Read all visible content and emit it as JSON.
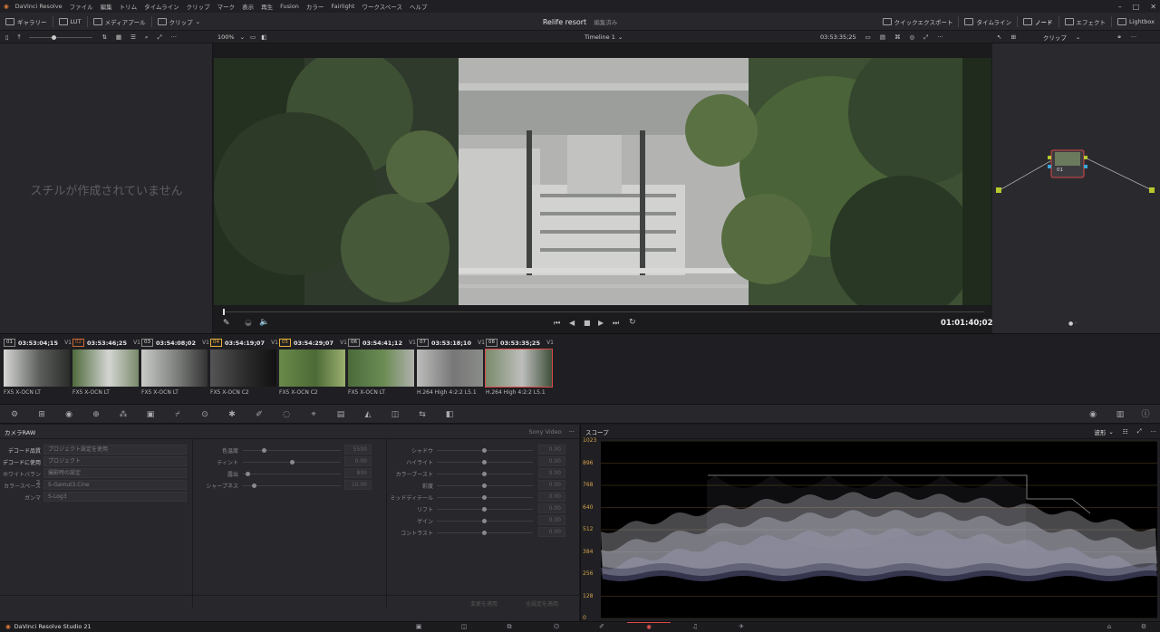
{
  "app": {
    "title": "DaVinci Resolve"
  },
  "menu": [
    "ファイル",
    "編集",
    "トリム",
    "タイムライン",
    "クリップ",
    "マーク",
    "表示",
    "再生",
    "Fusion",
    "カラー",
    "Fairlight",
    "ワークスペース",
    "ヘルプ"
  ],
  "window_controls": [
    "–",
    "□",
    "✕"
  ],
  "toolbar": {
    "gallery": "ギャラリー",
    "lut": "LUT",
    "media_pool": "メディアプール",
    "clips": "クリップ",
    "project": "Relife resort",
    "project_status": "編集済み",
    "quick_export": "クイックエクスポート",
    "timeline": "タイムライン",
    "nodes": "ノード",
    "effects": "エフェクト",
    "lightbox": "Lightbox"
  },
  "viewbar": {
    "zoom": "100%",
    "timeline": "Timeline 1",
    "timecode": "03:53:35;25",
    "clip_mode": "クリップ"
  },
  "gallery": {
    "empty": "スチルが作成されていません"
  },
  "viewer": {
    "timecode": "01:01:40;02"
  },
  "node": {
    "label": "01"
  },
  "clips": [
    {
      "num": "01",
      "tc": "03:53:04;15",
      "track": "V1",
      "name": "FX5 X-OCN LT",
      "color": "#888"
    },
    {
      "num": "02",
      "tc": "03:53:46;25",
      "track": "V1",
      "name": "FX5 X-OCN LT",
      "color": "#cc6a2f"
    },
    {
      "num": "03",
      "tc": "03:54:08;02",
      "track": "V1",
      "name": "FX5 X-OCN LT",
      "color": "#888"
    },
    {
      "num": "04",
      "tc": "03:54:19;07",
      "track": "V1",
      "name": "FX5 X-OCN C2",
      "color": "#e8b13a"
    },
    {
      "num": "05",
      "tc": "03:54:29;07",
      "track": "V1",
      "name": "FX5 X-OCN C2",
      "color": "#e8b13a"
    },
    {
      "num": "06",
      "tc": "03:54:41;12",
      "track": "V1",
      "name": "FX5 X-OCN LT",
      "color": "#888"
    },
    {
      "num": "07",
      "tc": "03:53:18;10",
      "track": "V1",
      "name": "H.264 High 4:2:2 L5.1",
      "color": "#888"
    },
    {
      "num": "08",
      "tc": "03:53:35;25",
      "track": "V1",
      "name": "H.264 High 4:2:2 L5.1",
      "color": "#888"
    }
  ],
  "raw": {
    "title": "カメラRAW",
    "source": "Sony Video",
    "left": [
      {
        "label": "デコード品質",
        "value": "プロジェクト設定を使用"
      },
      {
        "label": "デコードに使用",
        "value": "プロジェクト"
      },
      {
        "label": "ホワイトバランス",
        "value": "撮影時の設定"
      },
      {
        "label": "カラースペース",
        "value": "S-Gamut3.Cine"
      },
      {
        "label": "ガンマ",
        "value": "S-Log3"
      }
    ],
    "mid": [
      {
        "label": "色温度",
        "value": "5500"
      },
      {
        "label": "ティント",
        "value": "0.00"
      },
      {
        "label": "露出",
        "value": "800"
      },
      {
        "label": "シャープネス",
        "value": "10.00"
      }
    ],
    "right": [
      {
        "label": "シャドウ",
        "value": "0.00"
      },
      {
        "label": "ハイライト",
        "value": "0.00"
      },
      {
        "label": "カラーブースト",
        "value": "0.00"
      },
      {
        "label": "彩度",
        "value": "0.00"
      },
      {
        "label": "ミッドディテール",
        "value": "0.00"
      },
      {
        "label": "リフト",
        "value": "0.00"
      },
      {
        "label": "ゲイン",
        "value": "0.00"
      },
      {
        "label": "コントラスト",
        "value": "0.00"
      }
    ],
    "apply": "変更を適用",
    "apply_all": "全設定を適用"
  },
  "scope": {
    "title": "スコープ",
    "mode": "波形",
    "y_ticks": [
      "1023",
      "896",
      "768",
      "640",
      "512",
      "384",
      "256",
      "128",
      "0"
    ]
  },
  "footer": {
    "brand": "DaVinci Resolve Studio 21"
  }
}
